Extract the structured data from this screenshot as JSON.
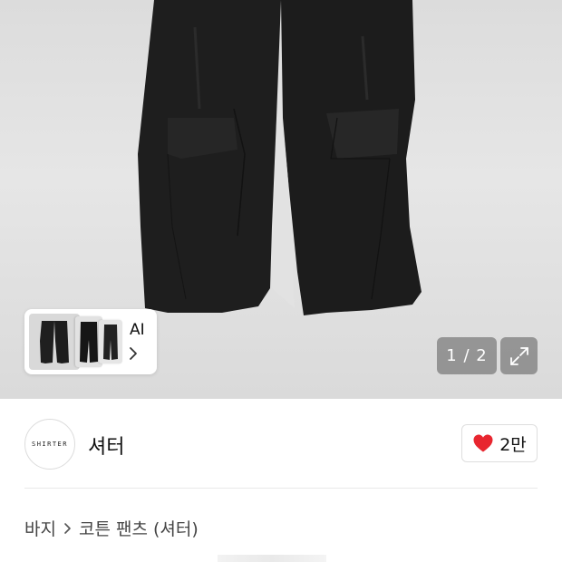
{
  "gallery": {
    "page_counter": "1 / 2",
    "current_page": 1,
    "total_pages": 2
  },
  "ai_similar": {
    "label": "AI"
  },
  "shop": {
    "logo_text": "SHIRTER",
    "name": "셔터"
  },
  "like": {
    "count_label": "2만",
    "heart_color": "#e8262f"
  },
  "breadcrumb": {
    "category": "바지",
    "product": "코튼 팬츠 (셔터)"
  },
  "icons": {
    "expand": "expand-icon",
    "chevron": "chevron-right-icon",
    "heart": "heart-icon"
  }
}
